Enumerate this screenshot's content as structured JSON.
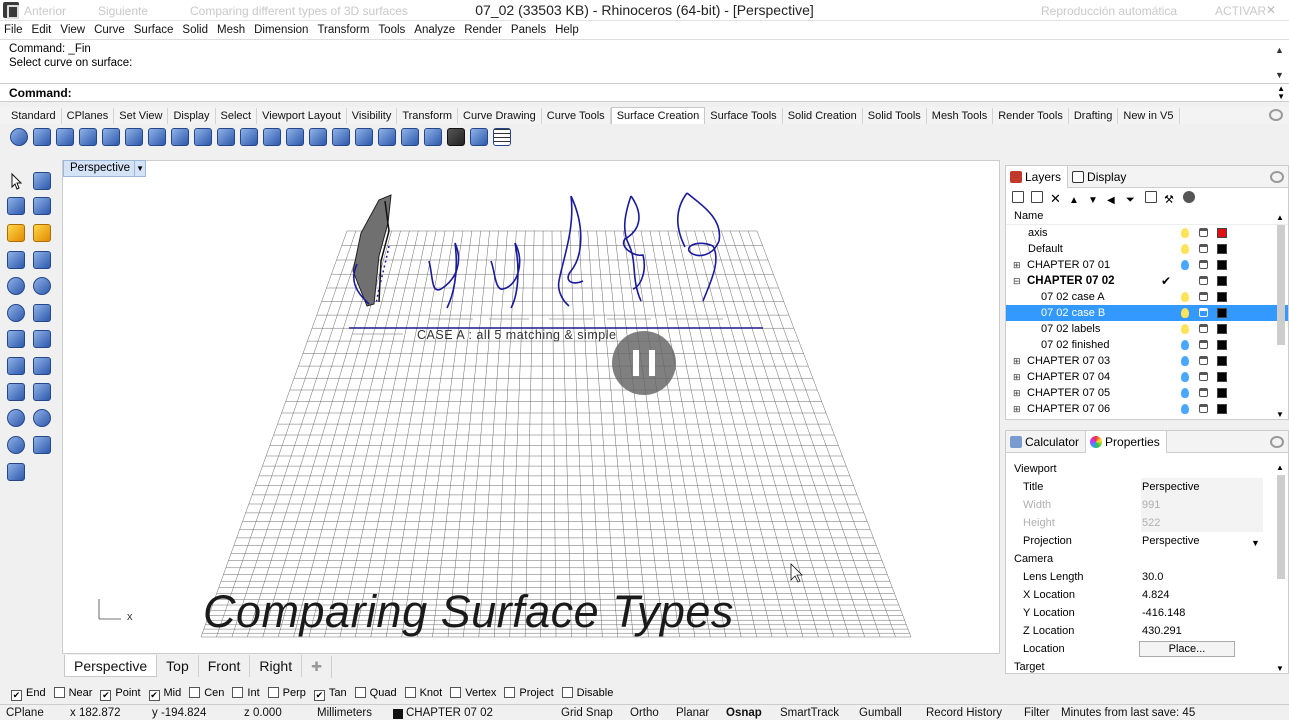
{
  "window": {
    "title": "07_02  (33503 KB) - Rhinoceros  (64-bit) - [Perspective]",
    "ghost_prev": "Anterior",
    "ghost_next": "Siguiente",
    "ghost_lesson": "Comparing different types of 3D surfaces",
    "ghost_autoplay": "Reproducción automática",
    "ghost_toggle": "ACTIVAR"
  },
  "menu": [
    "File",
    "Edit",
    "View",
    "Curve",
    "Surface",
    "Solid",
    "Mesh",
    "Dimension",
    "Transform",
    "Tools",
    "Analyze",
    "Render",
    "Panels",
    "Help"
  ],
  "command": {
    "history": [
      "Command: _Fin",
      "Select curve on surface:"
    ],
    "prompt": "Command:"
  },
  "toolbar_tabs": [
    "Standard",
    "CPlanes",
    "Set View",
    "Display",
    "Select",
    "Viewport Layout",
    "Visibility",
    "Transform",
    "Curve Drawing",
    "Curve Tools",
    "Surface Creation",
    "Surface Tools",
    "Solid Creation",
    "Solid Tools",
    "Mesh Tools",
    "Render Tools",
    "Drafting",
    "New in V5"
  ],
  "active_toolbar_tab": "Surface Creation",
  "toolbar_icons": [
    "surface-corner-points-icon",
    "surface-edge-curves-icon",
    "surface-planar-curves-icon",
    "surface-plane-icon",
    "surface-vertical-plane-icon",
    "surface-corner-plane-icon",
    "surface-extrude-icon",
    "surface-loft-icon",
    "surface-rail-revolve-icon",
    "surface-revolve-icon",
    "surface-sweep1-icon",
    "surface-sweep2-icon",
    "surface-patch-icon",
    "surface-network-icon",
    "surface-drape-icon",
    "surface-heightfield-icon",
    "surface-blend-icon",
    "surface-from-points-icon",
    "surface-fit-icon",
    "surface-patch-grid-icon",
    "surface-cap-icon",
    "surface-point-grid-icon"
  ],
  "viewport": {
    "name": "Perspective",
    "caption": "Comparing Surface Types",
    "annotation": "CASE A : all 5 matching & simple",
    "axis_label": "x"
  },
  "viewport_tabs": [
    "Perspective",
    "Top",
    "Front",
    "Right"
  ],
  "active_viewport_tab": "Perspective",
  "panels": {
    "layers_tab": "Layers",
    "display_tab": "Display",
    "name_header": "Name",
    "layers": [
      {
        "name": "axis",
        "level": 0,
        "expand": "",
        "bulb": "#ffe35a",
        "color": "#dd1111",
        "bold": false,
        "selected": false,
        "current": false
      },
      {
        "name": "Default",
        "level": 0,
        "expand": "",
        "bulb": "#ffe35a",
        "color": "#000000",
        "bold": false,
        "selected": false,
        "current": false
      },
      {
        "name": "CHAPTER 07 01",
        "level": 0,
        "expand": "+",
        "bulb": "#4aa8ff",
        "color": "#000000",
        "bold": false,
        "selected": false,
        "current": false
      },
      {
        "name": "CHAPTER 07 02",
        "level": 0,
        "expand": "-",
        "bulb": "",
        "color": "#000000",
        "bold": true,
        "selected": false,
        "current": true
      },
      {
        "name": "07 02 case A",
        "level": 1,
        "expand": "",
        "bulb": "#ffe35a",
        "color": "#000000",
        "bold": false,
        "selected": false,
        "current": false
      },
      {
        "name": "07 02 case B",
        "level": 1,
        "expand": "",
        "bulb": "#ffe35a",
        "color": "#000000",
        "bold": false,
        "selected": true,
        "current": false
      },
      {
        "name": "07 02 labels",
        "level": 1,
        "expand": "",
        "bulb": "#ffe35a",
        "color": "#000000",
        "bold": false,
        "selected": false,
        "current": false
      },
      {
        "name": "07 02 finished",
        "level": 1,
        "expand": "",
        "bulb": "#4aa8ff",
        "color": "#000000",
        "bold": false,
        "selected": false,
        "current": false
      },
      {
        "name": "CHAPTER 07 03",
        "level": 0,
        "expand": "+",
        "bulb": "#4aa8ff",
        "color": "#000000",
        "bold": false,
        "selected": false,
        "current": false
      },
      {
        "name": "CHAPTER 07 04",
        "level": 0,
        "expand": "+",
        "bulb": "#4aa8ff",
        "color": "#000000",
        "bold": false,
        "selected": false,
        "current": false
      },
      {
        "name": "CHAPTER 07 05",
        "level": 0,
        "expand": "+",
        "bulb": "#4aa8ff",
        "color": "#000000",
        "bold": false,
        "selected": false,
        "current": false
      },
      {
        "name": "CHAPTER 07 06",
        "level": 0,
        "expand": "+",
        "bulb": "#4aa8ff",
        "color": "#000000",
        "bold": false,
        "selected": false,
        "current": false
      }
    ],
    "calc_tab": "Calculator",
    "props_tab": "Properties",
    "properties": [
      {
        "label": "Viewport",
        "value": "",
        "kind": "section"
      },
      {
        "label": "Title",
        "value": "Perspective",
        "kind": "shade"
      },
      {
        "label": "Width",
        "value": "991",
        "kind": "dim"
      },
      {
        "label": "Height",
        "value": "522",
        "kind": "dim"
      },
      {
        "label": "Projection",
        "value": "Perspective",
        "kind": "dropdown"
      },
      {
        "label": "Camera",
        "value": "",
        "kind": "section"
      },
      {
        "label": "Lens Length",
        "value": "30.0",
        "kind": ""
      },
      {
        "label": "X Location",
        "value": "4.824",
        "kind": ""
      },
      {
        "label": "Y Location",
        "value": "-416.148",
        "kind": ""
      },
      {
        "label": "Z Location",
        "value": "430.291",
        "kind": ""
      },
      {
        "label": "Location",
        "value": "Place...",
        "kind": "button"
      },
      {
        "label": "Target",
        "value": "",
        "kind": "section"
      }
    ]
  },
  "osnaps": [
    {
      "label": "End",
      "checked": true
    },
    {
      "label": "Near",
      "checked": false
    },
    {
      "label": "Point",
      "checked": true
    },
    {
      "label": "Mid",
      "checked": true
    },
    {
      "label": "Cen",
      "checked": false
    },
    {
      "label": "Int",
      "checked": false
    },
    {
      "label": "Perp",
      "checked": false
    },
    {
      "label": "Tan",
      "checked": true
    },
    {
      "label": "Quad",
      "checked": false
    },
    {
      "label": "Knot",
      "checked": false
    },
    {
      "label": "Vertex",
      "checked": false
    },
    {
      "label": "Project",
      "checked": false
    },
    {
      "label": "Disable",
      "checked": false
    }
  ],
  "status": {
    "cplane": "CPlane",
    "x": "x 182.872",
    "y": "y -194.824",
    "z": "z 0.000",
    "units": "Millimeters",
    "layer": "CHAPTER 07 02",
    "grid_snap": "Grid Snap",
    "ortho": "Ortho",
    "planar": "Planar",
    "osnap": "Osnap",
    "smarttrack": "SmartTrack",
    "gumball": "Gumball",
    "record_history": "Record History",
    "filter": "Filter",
    "save": "Minutes from last save: 45"
  }
}
